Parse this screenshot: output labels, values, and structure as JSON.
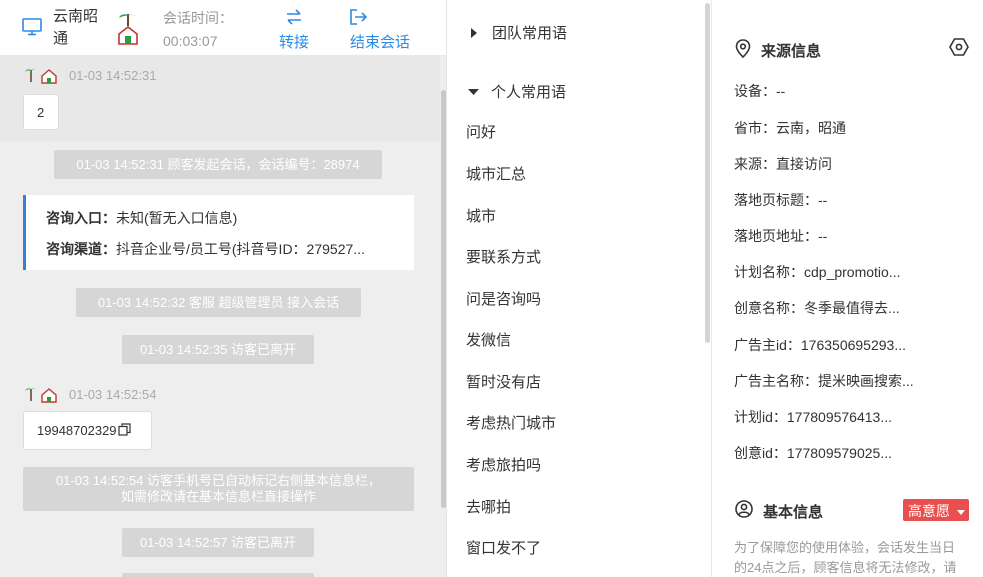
{
  "header": {
    "location": "云南昭通",
    "session_time_label": "会话时间：",
    "session_time": "00:03:07",
    "transfer_label": "转接",
    "end_label": "结束会话"
  },
  "chat": {
    "msg1": {
      "time": "01-03 14:52:31",
      "text": "2"
    },
    "sys1": "01-03 14:52:31 顾客发起会话，会话编号：28974",
    "card": {
      "entry_label": "咨询入口：",
      "entry_value": "未知(暂无入口信息)",
      "channel_label": "咨询渠道：",
      "channel_value": "抖音企业号/员工号(抖音号ID：279527..."
    },
    "sys2": "01-03 14:52:32 客服 超级管理员 接入会话",
    "sys3": "01-03 14:52:35 访客已离开",
    "msg2": {
      "time": "01-03 14:52:54",
      "text": "19948702329"
    },
    "sys4_line1": "01-03 14:52:54 访客手机号已自动标记右侧基本信息栏，",
    "sys4_line2": "如需修改请在基本信息栏直接操作",
    "sys5": "01-03 14:52:57 访客已离开"
  },
  "phrases": {
    "team_group": "团队常用语",
    "personal_group": "个人常用语",
    "items": [
      "问好",
      "城市汇总",
      "城市",
      "要联系方式",
      "问是咨询吗",
      "发微信",
      "暂时没有店",
      "考虑热门城市",
      "考虑旅拍吗",
      "去哪拍",
      "窗口发不了"
    ]
  },
  "source_info": {
    "title": "来源信息",
    "rows": [
      "设备：--",
      "省市：云南，昭通",
      "来源：直接访问",
      "落地页标题：--",
      "落地页地址：--",
      "计划名称：cdp_promotio...",
      "创意名称：冬季最值得去...",
      "广告主id：176350695293...",
      "广告主名称：提米映画搜索...",
      "计划id：177809576413...",
      "创意id：177809579025..."
    ]
  },
  "basic_info": {
    "title": "基本信息",
    "intent_badge": "高意愿",
    "note": "为了保障您的使用体验，会话发生当日的24点之后，顾客信息将无法修改，请"
  },
  "colors": {
    "accent": "#2b8be6",
    "badge": "#e8504f",
    "card_border": "#3a7fd5",
    "system_bg": "#d6d6d6"
  }
}
